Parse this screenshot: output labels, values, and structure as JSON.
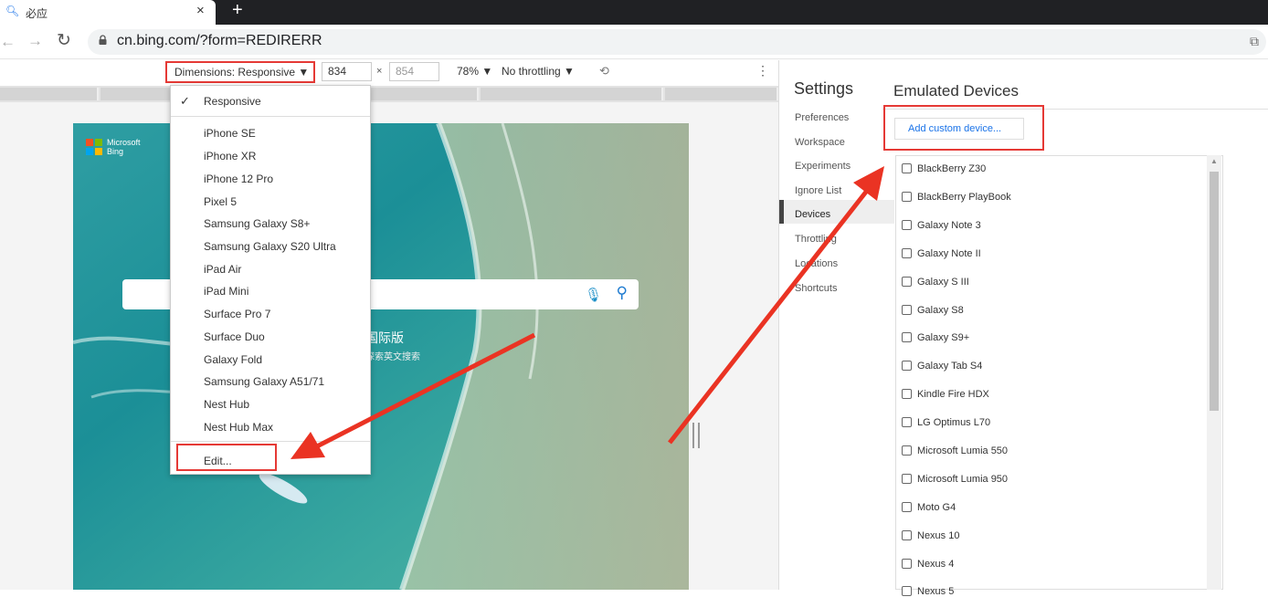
{
  "colors": {
    "highlight_red": "#e53935",
    "arrow_red": "#ea3323",
    "link_blue": "#1a73e8"
  },
  "browser": {
    "tab_title": "必应",
    "url": "cn.bing.com/?form=REDIRERR"
  },
  "device_toolbar": {
    "dimensions_label": "Dimensions: Responsive ▼",
    "width_value": "834",
    "height_placeholder": "854",
    "times": "×",
    "zoom_label": "78% ▼",
    "throttling_label": "No throttling ▼"
  },
  "dimensions_menu": {
    "check": "✓",
    "responsive": "Responsive",
    "devices": [
      "iPhone SE",
      "iPhone XR",
      "iPhone 12 Pro",
      "Pixel 5",
      "Samsung Galaxy S8+",
      "Samsung Galaxy S20 Ultra",
      "iPad Air",
      "iPad Mini",
      "Surface Pro 7",
      "Surface Duo",
      "Galaxy Fold",
      "Samsung Galaxy A51/71",
      "Nest Hub",
      "Nest Hub Max"
    ],
    "edit": "Edit..."
  },
  "page": {
    "logo_line1": "Microsoft",
    "logo_line2": "Bing",
    "promo_title": "国际版",
    "promo_sub": "探索英文搜索"
  },
  "settings": {
    "title": "Settings",
    "nav": [
      "Preferences",
      "Workspace",
      "Experiments",
      "Ignore List",
      "Devices",
      "Throttling",
      "Locations",
      "Shortcuts"
    ],
    "active": "Devices",
    "section_title": "Emulated Devices",
    "add_button": "Add custom device...",
    "emulated_devices": [
      "BlackBerry Z30",
      "BlackBerry PlayBook",
      "Galaxy Note 3",
      "Galaxy Note II",
      "Galaxy S III",
      "Galaxy S8",
      "Galaxy S9+",
      "Galaxy Tab S4",
      "Kindle Fire HDX",
      "LG Optimus L70",
      "Microsoft Lumia 550",
      "Microsoft Lumia 950",
      "Moto G4",
      "Nexus 10",
      "Nexus 4",
      "Nexus 5"
    ]
  }
}
